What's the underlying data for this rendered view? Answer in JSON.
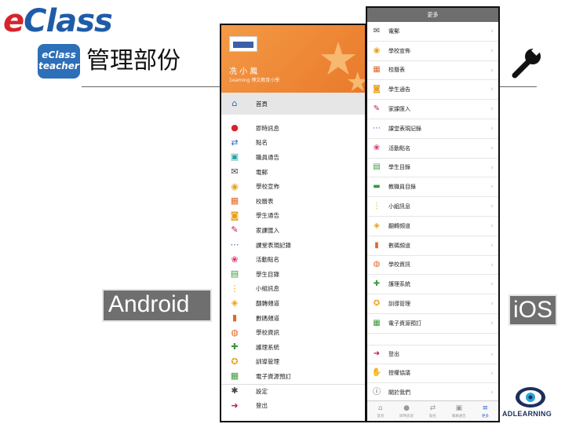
{
  "slide": {
    "logo_e": "e",
    "logo_class": "Class",
    "badge_line1": "eClass",
    "badge_line2": "teacher",
    "title": "管理部份",
    "android_label": "Android",
    "ios_label": "iOS",
    "brand_footer": "ADLEARNING"
  },
  "android": {
    "user_name": "冼 小 鳳",
    "school": "1eaming 博文教育小學",
    "items": [
      {
        "label": "首頁",
        "icon": "home-icon",
        "glyph": "⌂",
        "color": "#2e66c8"
      },
      {
        "label": "即時訊息",
        "icon": "alert-icon",
        "glyph": "●",
        "color": "#d8232a"
      },
      {
        "label": "點名",
        "icon": "swap-icon",
        "glyph": "⇄",
        "color": "#2e66c8"
      },
      {
        "label": "職員通告",
        "icon": "notice-icon",
        "glyph": "▣",
        "color": "#29a4a8"
      },
      {
        "label": "電郵",
        "icon": "mail-icon",
        "glyph": "✉",
        "color": "#444444"
      },
      {
        "label": "學校宣佈",
        "icon": "broadcast-icon",
        "glyph": "◉",
        "color": "#e8a21a"
      },
      {
        "label": "校曆表",
        "icon": "calendar-icon",
        "glyph": "▦",
        "color": "#e06a2a"
      },
      {
        "label": "學生通告",
        "icon": "student-notice-icon",
        "glyph": "◙",
        "color": "#e8a21a"
      },
      {
        "label": "家課匯入",
        "icon": "homework-icon",
        "glyph": "✎",
        "color": "#c2185b"
      },
      {
        "label": "課堂表現記錄",
        "icon": "performance-icon",
        "glyph": "⋯",
        "color": "#2e66c8"
      },
      {
        "label": "活動點名",
        "icon": "activity-icon",
        "glyph": "❀",
        "color": "#d6336c"
      },
      {
        "label": "學生目錄",
        "icon": "directory-icon",
        "glyph": "▤",
        "color": "#3c9a3c"
      },
      {
        "label": "小組訊息",
        "icon": "group-icon",
        "glyph": "⋮",
        "color": "#e8a21a"
      },
      {
        "label": "翻轉頻道",
        "icon": "flip-channel-icon",
        "glyph": "◈",
        "color": "#e8a21a"
      },
      {
        "label": "數碼頻道",
        "icon": "digital-channel-icon",
        "glyph": "▮",
        "color": "#e06a2a"
      },
      {
        "label": "學校資訊",
        "icon": "school-info-icon",
        "glyph": "◍",
        "color": "#e06a2a"
      },
      {
        "label": "護理系統",
        "icon": "medical-icon",
        "glyph": "✚",
        "color": "#3c9a3c"
      },
      {
        "label": "訓導管理",
        "icon": "discipline-icon",
        "glyph": "✪",
        "color": "#e8a21a"
      },
      {
        "label": "電子資源預訂",
        "icon": "booking-icon",
        "glyph": "▦",
        "color": "#3c9a3c"
      },
      {
        "label": "設定",
        "icon": "gear-icon",
        "glyph": "✱",
        "color": "#444444"
      },
      {
        "label": "登出",
        "icon": "logout-icon",
        "glyph": "➜",
        "color": "#c2185b"
      }
    ]
  },
  "ios": {
    "title": "更多",
    "items": [
      {
        "label": "電郵",
        "icon": "mail-icon",
        "glyph": "✉",
        "color": "#444444"
      },
      {
        "label": "學校宣佈",
        "icon": "broadcast-icon",
        "glyph": "◉",
        "color": "#e8a21a"
      },
      {
        "label": "校曆表",
        "icon": "calendar-icon",
        "glyph": "▦",
        "color": "#e06a2a"
      },
      {
        "label": "學生通告",
        "icon": "student-notice-icon",
        "glyph": "◙",
        "color": "#e8a21a"
      },
      {
        "label": "家課匯入",
        "icon": "homework-icon",
        "glyph": "✎",
        "color": "#c2185b"
      },
      {
        "label": "課堂表現記錄",
        "icon": "performance-icon",
        "glyph": "⋯",
        "color": "#2e66c8"
      },
      {
        "label": "活動點名",
        "icon": "activity-icon",
        "glyph": "❀",
        "color": "#d6336c"
      },
      {
        "label": "學生目錄",
        "icon": "directory-icon",
        "glyph": "▤",
        "color": "#3c9a3c"
      },
      {
        "label": "教職員目錄",
        "icon": "staff-directory-icon",
        "glyph": "▬",
        "color": "#3c9a3c"
      },
      {
        "label": "小組訊息",
        "icon": "group-icon",
        "glyph": "⋮",
        "color": "#e8a21a"
      },
      {
        "label": "翻轉頻道",
        "icon": "flip-channel-icon",
        "glyph": "◈",
        "color": "#e8a21a"
      },
      {
        "label": "數碼頻道",
        "icon": "digital-channel-icon",
        "glyph": "▮",
        "color": "#e06a2a"
      },
      {
        "label": "學校資訊",
        "icon": "school-info-icon",
        "glyph": "◍",
        "color": "#e06a2a"
      },
      {
        "label": "護理系統",
        "icon": "medical-icon",
        "glyph": "✚",
        "color": "#3c9a3c"
      },
      {
        "label": "訓導管理",
        "icon": "discipline-icon",
        "glyph": "✪",
        "color": "#e8a21a"
      },
      {
        "label": "電子資源預訂",
        "icon": "booking-icon",
        "glyph": "▦",
        "color": "#3c9a3c"
      },
      {
        "label": "登出",
        "icon": "logout-icon",
        "glyph": "➜",
        "color": "#c2185b"
      },
      {
        "label": "授權協議",
        "icon": "license-icon",
        "glyph": "✋",
        "color": "#2e66c8"
      },
      {
        "label": "關於我們",
        "icon": "info-icon",
        "glyph": "ⓘ",
        "color": "#444444"
      }
    ],
    "tabs": [
      {
        "label": "首頁",
        "icon": "home-icon",
        "glyph": "⌂"
      },
      {
        "label": "即時訊息",
        "icon": "alert-icon",
        "glyph": "●"
      },
      {
        "label": "點名",
        "icon": "swap-icon",
        "glyph": "⇄"
      },
      {
        "label": "職員通告",
        "icon": "notice-icon",
        "glyph": "▣"
      },
      {
        "label": "更多",
        "icon": "menu-icon",
        "glyph": "≡",
        "active": true
      }
    ]
  }
}
